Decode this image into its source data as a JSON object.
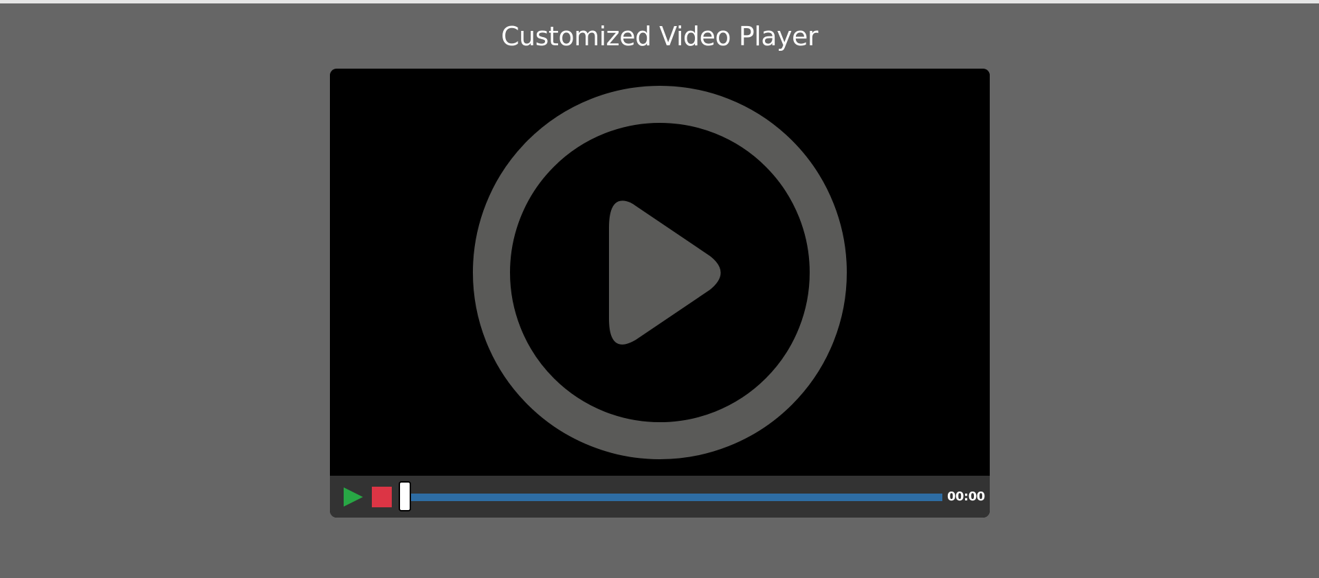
{
  "page": {
    "title": "Customized Video Player",
    "background_color": "#666666"
  },
  "player": {
    "screen_overlay_icon": "play-circle-icon",
    "controls": {
      "play_icon": "play-icon",
      "play_color": "#28a745",
      "stop_icon": "stop-icon",
      "stop_color": "#dc3545",
      "progress": 0,
      "progress_color": "#2e6da4",
      "time": "00:00"
    }
  }
}
